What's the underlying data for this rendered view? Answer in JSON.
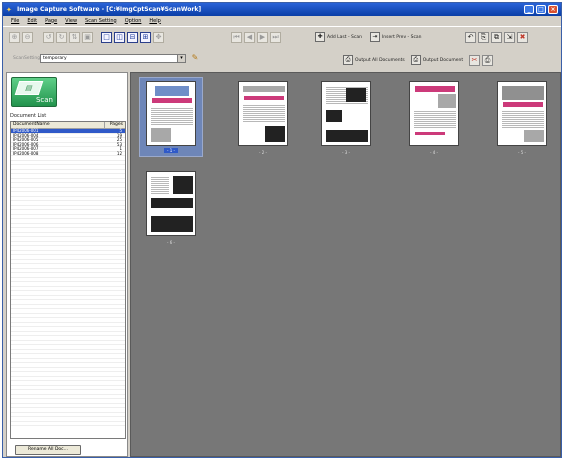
{
  "window": {
    "title": "Image Capture Software - [C:¥ImgCptScan¥ScanWork]",
    "buttons": [
      "_",
      "□",
      "×"
    ]
  },
  "menu": [
    "File",
    "Edit",
    "Page",
    "View",
    "Scan Setting",
    "Option",
    "Help"
  ],
  "toolbar": {
    "add_last_scan": "Add Last - Scan",
    "insert_prev_scan": "Insert Prev - Scan",
    "output_all_documents": "Output All Documents",
    "output_document": "Output Document"
  },
  "scan_setting": {
    "label": "ScanSetting",
    "value": "temporary"
  },
  "left_pane": {
    "scan_button": "Scan",
    "document_list_label": "Document List",
    "columns": [
      "DocumentName",
      "Pages"
    ],
    "documents": [
      {
        "name": "IP42006-001",
        "pages": "5"
      },
      {
        "name": "IP42006-004",
        "pages": "19"
      },
      {
        "name": "IP42006-005",
        "pages": "25"
      },
      {
        "name": "IP42006-006",
        "pages": "53"
      },
      {
        "name": "IP42006-007",
        "pages": "1"
      },
      {
        "name": "IP42006-008",
        "pages": "12"
      }
    ],
    "rename_button": "Rename All Doc..."
  },
  "pages": [
    {
      "label": "- 1 -",
      "selected": true
    },
    {
      "label": "- 2 -",
      "selected": false
    },
    {
      "label": "- 3 -",
      "selected": false
    },
    {
      "label": "- 4 -",
      "selected": false
    },
    {
      "label": "- 5 -",
      "selected": false
    },
    {
      "label": "- 6 -",
      "selected": false
    }
  ],
  "icons": {
    "zoom": [
      "zoom-in-icon",
      "zoom-out-icon"
    ],
    "layout": [
      "single-page-icon",
      "two-page-icon",
      "split-icon",
      "grid-icon"
    ],
    "nav": [
      "first-page-icon",
      "prev-page-icon",
      "next-page-icon",
      "last-page-icon"
    ]
  },
  "colors": {
    "title_bar": "#0a3ea6",
    "selection": "#2f59c8",
    "scan_button": "#22934d",
    "canvas": "#777777"
  }
}
